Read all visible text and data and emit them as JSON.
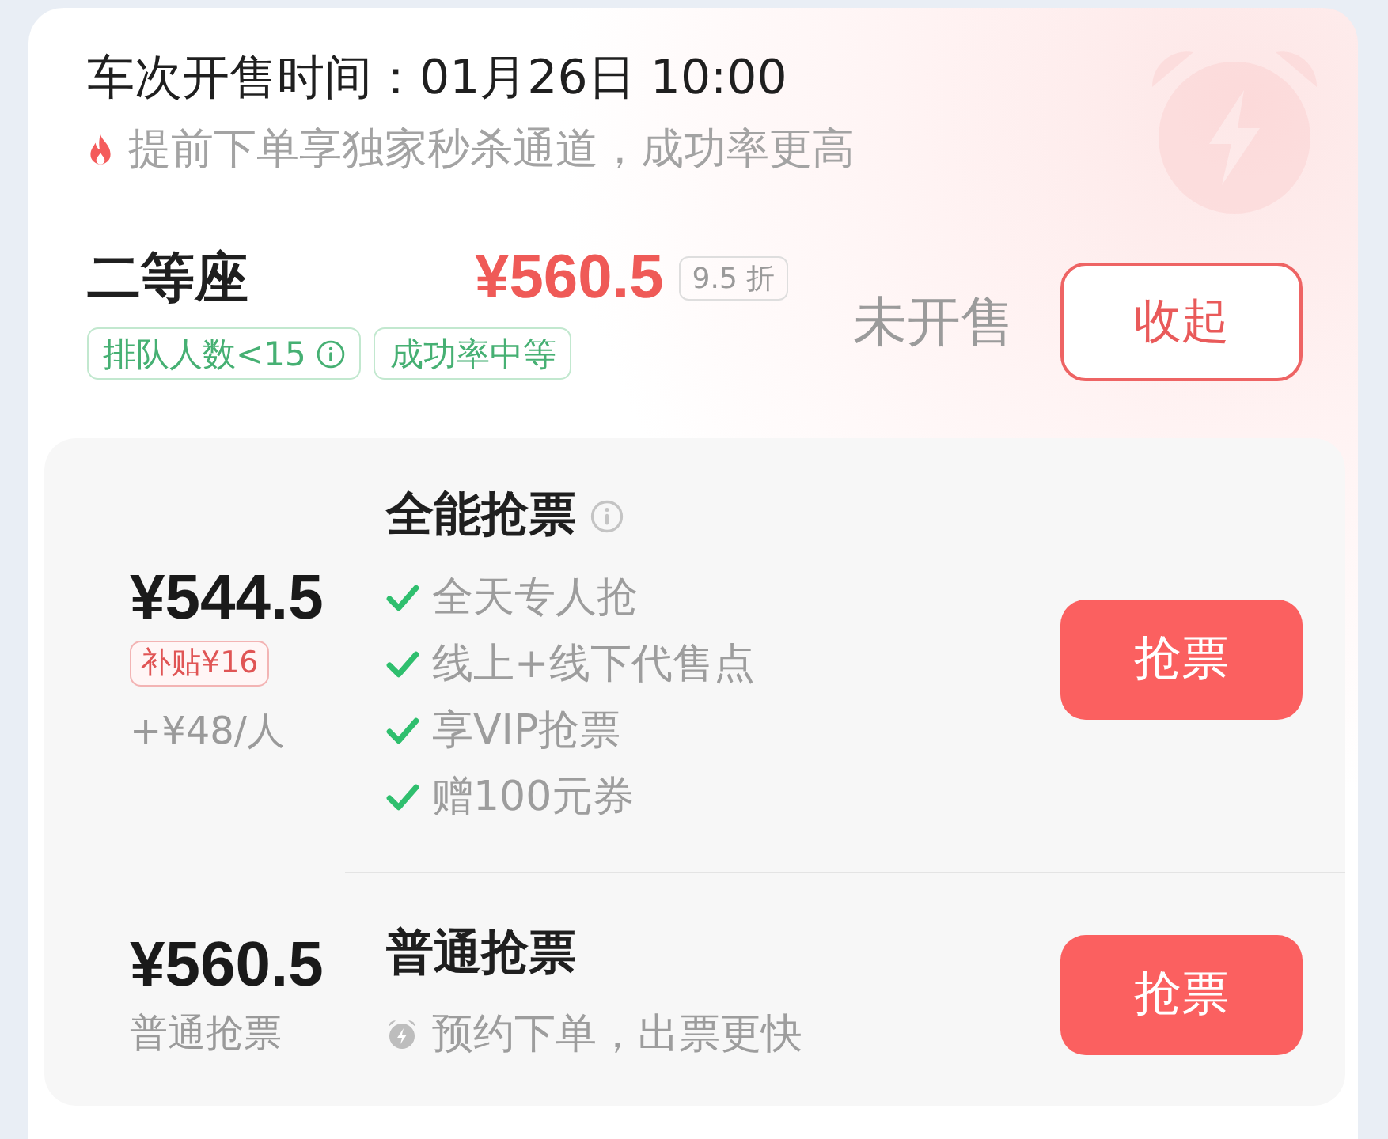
{
  "sale_info": {
    "title": "车次开售时间：01月26日 10:00",
    "note": "提前下单享独家秒杀通道，成功率更高"
  },
  "seat": {
    "name": "二等座",
    "price": "¥560.5",
    "discount": "9.5 折",
    "tags": [
      {
        "label": "排队人数<15",
        "info": true
      },
      {
        "label": "成功率中等",
        "info": false
      }
    ],
    "status": "未开售",
    "toggle_button": "收起"
  },
  "options": [
    {
      "kind": "premium",
      "price": "¥544.5",
      "subsidy": "补贴¥16",
      "surcharge": "+¥48/人",
      "title": "全能抢票",
      "info": true,
      "features": [
        "全天专人抢",
        "线上+线下代售点",
        "享VIP抢票",
        "赠100元券"
      ],
      "button": "抢票"
    },
    {
      "kind": "standard",
      "price": "¥560.5",
      "subtitle": "普通抢票",
      "title": "普通抢票",
      "info": false,
      "note": "预约下单，出票更快",
      "button": "抢票"
    }
  ]
}
